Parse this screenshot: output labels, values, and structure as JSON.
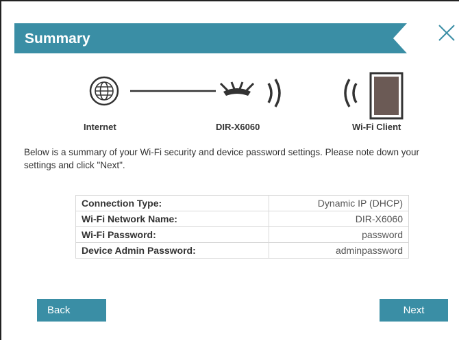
{
  "dialog": {
    "title": "Summary"
  },
  "diagram": {
    "internet_label": "Internet",
    "router_label": "DIR-X6060",
    "client_label": "Wi-Fi Client"
  },
  "intro_text": "Below is a summary of your Wi-Fi security and device password settings. Please note down your settings and click \"Next\".",
  "summary_rows": [
    {
      "label": "Connection Type:",
      "value": "Dynamic IP (DHCP)"
    },
    {
      "label": "Wi-Fi Network Name:",
      "value": "DIR-X6060"
    },
    {
      "label": "Wi-Fi Password:",
      "value": "password"
    },
    {
      "label": "Device Admin Password:",
      "value": "adminpassword"
    }
  ],
  "buttons": {
    "back_label": "Back",
    "next_label": "Next"
  },
  "colors": {
    "accent": "#3a8ea5"
  }
}
